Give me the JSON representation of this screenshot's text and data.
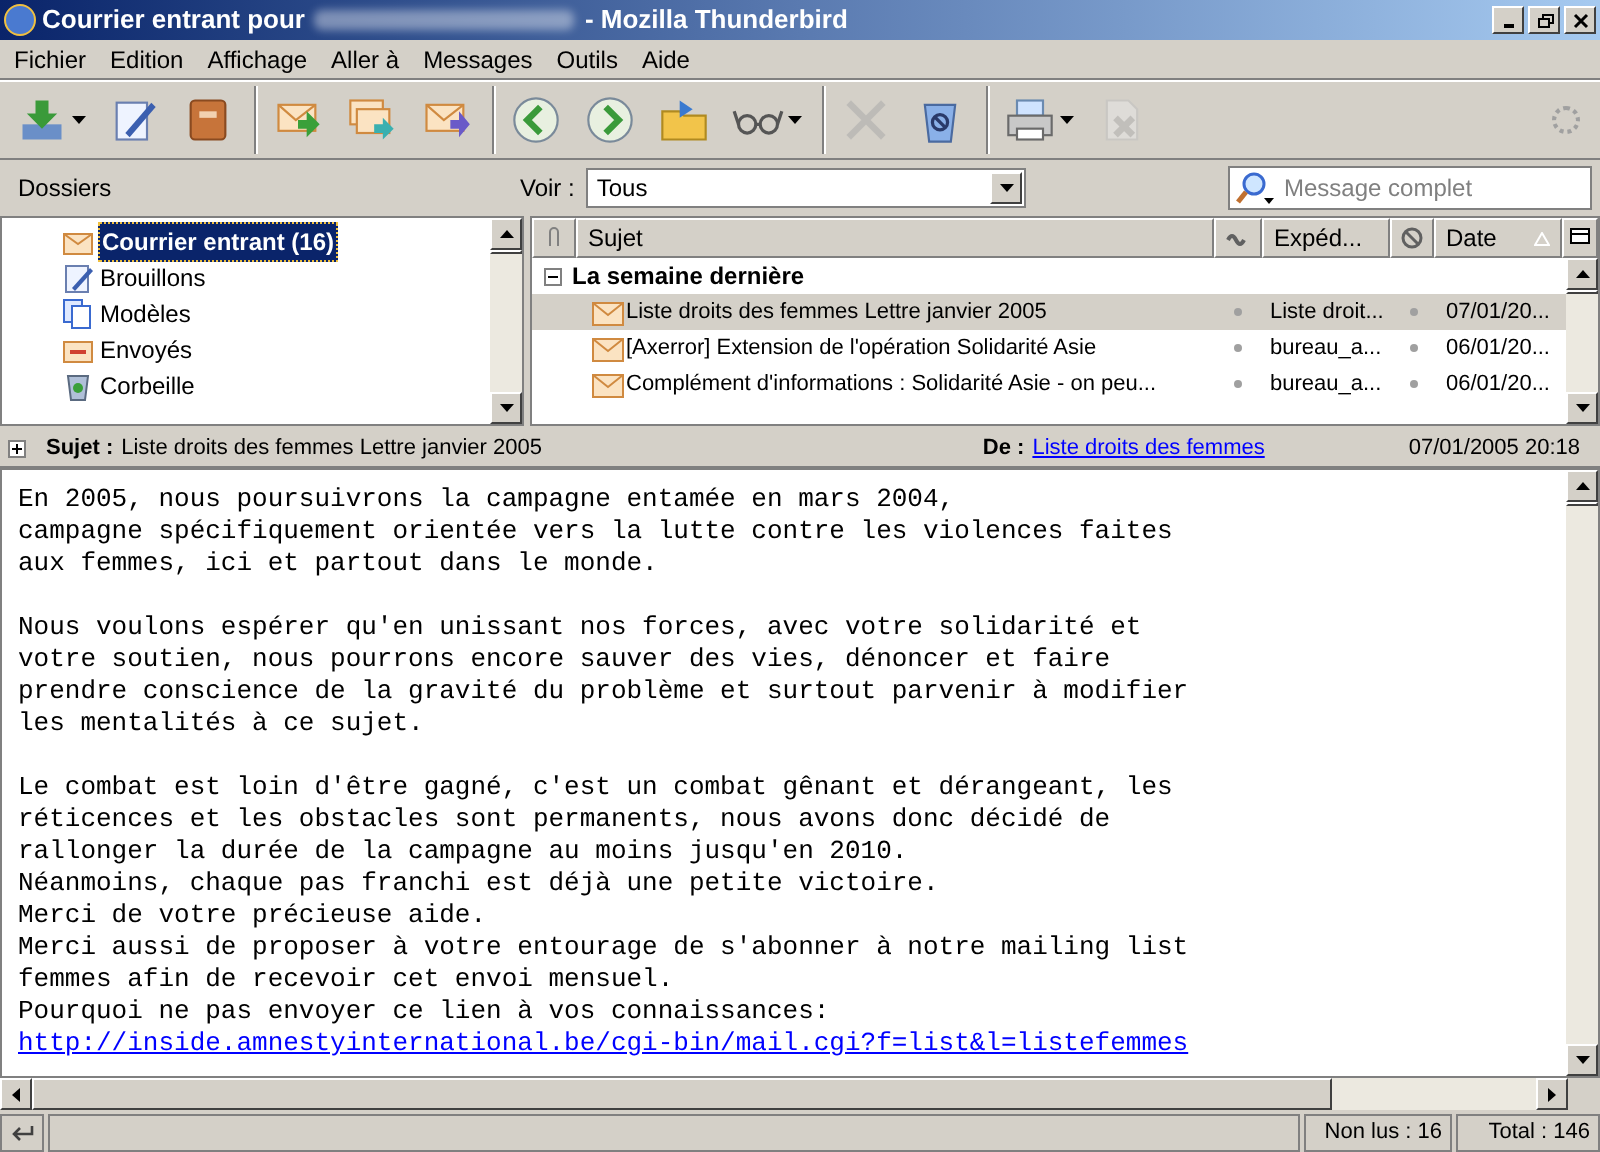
{
  "window": {
    "title": "Courrier entrant pour",
    "title_suffix": "- Mozilla Thunderbird"
  },
  "menu": [
    "Fichier",
    "Edition",
    "Affichage",
    "Aller à",
    "Messages",
    "Outils",
    "Aide"
  ],
  "toolbar": [
    {
      "kind": "button",
      "dropdown": true,
      "disabled": false
    },
    {
      "kind": "button",
      "dropdown": false,
      "disabled": false
    },
    {
      "kind": "button",
      "dropdown": false,
      "disabled": false
    },
    {
      "kind": "separator"
    },
    {
      "kind": "button",
      "dropdown": false,
      "disabled": false
    },
    {
      "kind": "button",
      "dropdown": false,
      "disabled": false
    },
    {
      "kind": "button",
      "dropdown": false,
      "disabled": false
    },
    {
      "kind": "separator"
    },
    {
      "kind": "button",
      "dropdown": false,
      "disabled": false
    },
    {
      "kind": "button",
      "dropdown": false,
      "disabled": false
    },
    {
      "kind": "button",
      "dropdown": false,
      "disabled": false
    },
    {
      "kind": "button",
      "dropdown": true,
      "disabled": false
    },
    {
      "kind": "separator"
    },
    {
      "kind": "button",
      "dropdown": false,
      "disabled": true
    },
    {
      "kind": "button",
      "dropdown": false,
      "disabled": false
    },
    {
      "kind": "separator"
    },
    {
      "kind": "button",
      "dropdown": true,
      "disabled": false
    },
    {
      "kind": "button",
      "dropdown": false,
      "disabled": true
    }
  ],
  "folders_label": "Dossiers",
  "view": {
    "label": "Voir :",
    "value": "Tous"
  },
  "search": {
    "placeholder": "Message complet"
  },
  "folders": [
    {
      "name": "Courrier entrant (16)",
      "selected": true
    },
    {
      "name": "Brouillons",
      "selected": false
    },
    {
      "name": "Modèles",
      "selected": false
    },
    {
      "name": "Envoyés",
      "selected": false
    },
    {
      "name": "Corbeille",
      "selected": false
    }
  ],
  "columns": [
    "Sujet",
    "Expéd...",
    "Date"
  ],
  "group": {
    "label": "La semaine dernière",
    "expanded": true
  },
  "messages": [
    {
      "subject": "Liste droits des femmes Lettre janvier 2005",
      "sender": "Liste droit...",
      "date": "07/01/20...",
      "selected": true
    },
    {
      "subject": "[Axerror] Extension de l'opération Solidarité Asie",
      "sender": "bureau_a...",
      "date": "06/01/20...",
      "selected": false
    },
    {
      "subject": "Complément d'informations : Solidarité Asie - on peu...",
      "sender": "bureau_a...",
      "date": "06/01/20...",
      "selected": false
    }
  ],
  "header": {
    "subject_label": "Sujet :",
    "subject": "Liste droits des femmes Lettre janvier 2005",
    "from_label": "De :",
    "from": "Liste droits des femmes",
    "date": "07/01/2005 20:18"
  },
  "body": [
    [
      "En 2005, nous poursuivrons la campagne entamée en mars 2004,",
      "campagne spécifiquement orientée vers la lutte contre les violences faites",
      "aux femmes, ici et partout dans le monde."
    ],
    [
      "Nous voulons espérer qu'en unissant nos forces, avec votre solidarité et",
      "votre soutien, nous pourrons encore sauver des vies, dénoncer et faire",
      "prendre conscience de la gravité du problème et surtout parvenir à modifier",
      "les mentalités à ce sujet."
    ],
    [
      "Le combat est loin d'être gagné, c'est un combat gênant et dérangeant, les",
      "réticences et les obstacles sont permanents, nous avons donc décidé de",
      "rallonger la durée de la campagne au moins jusqu'en 2010.",
      "Néanmoins, chaque pas franchi est déjà une petite victoire.",
      "Merci de votre précieuse aide.",
      "Merci aussi de proposer à votre entourage de s'abonner à notre mailing list",
      "femmes afin de recevoir cet envoi mensuel.",
      "Pourquoi ne pas envoyer ce lien à vos connaissances:"
    ]
  ],
  "body_link": "http://inside.amnestyinternational.be/cgi-bin/mail.cgi?f=list&l=listefemmes",
  "status": {
    "unread": "Non lus : 16",
    "total": "Total : 146"
  }
}
